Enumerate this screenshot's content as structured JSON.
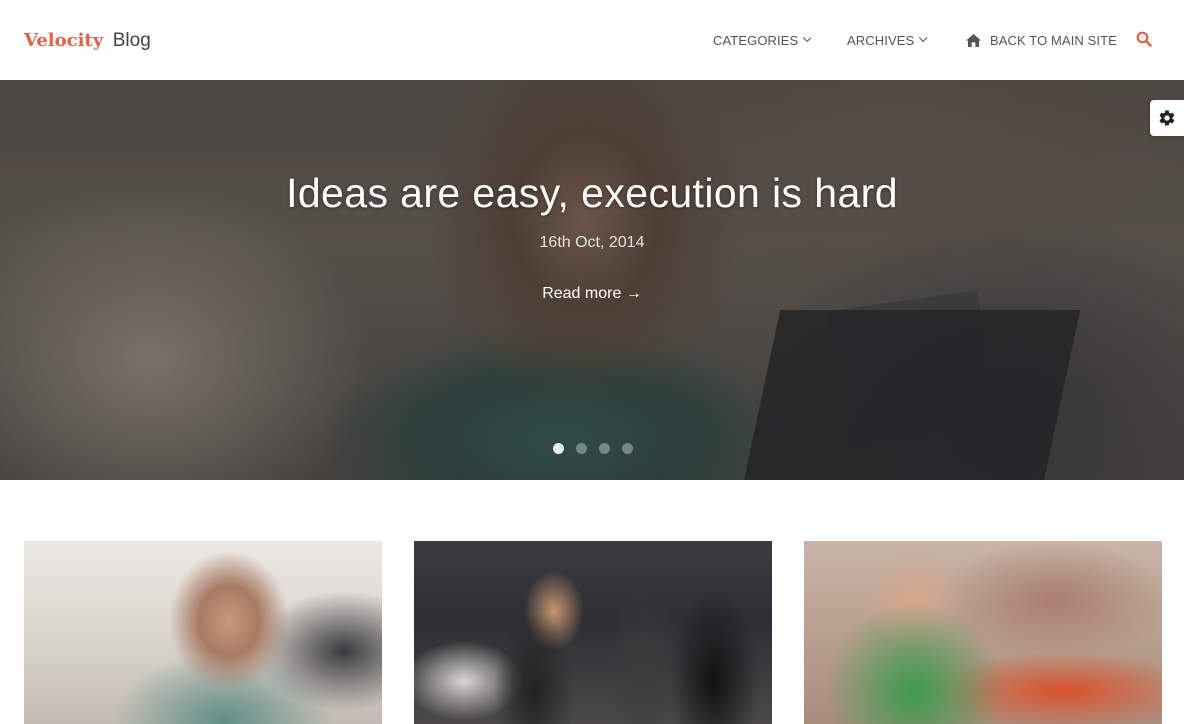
{
  "header": {
    "logo_brand": "Velocity",
    "logo_suffix": "Blog",
    "nav": {
      "categories": "CATEGORIES",
      "archives": "ARCHIVES",
      "back": "BACK TO MAIN SITE"
    },
    "icons": {
      "home": "home-icon",
      "search": "search-icon",
      "chevron": "chevron-down-icon"
    },
    "accent_color": "#e5624a"
  },
  "hero": {
    "title": "Ideas are easy, execution is hard",
    "date": "16th Oct, 2014",
    "read_more": "Read more →",
    "slides_total": 4,
    "active_slide": 1
  },
  "settings": {
    "icon": "gear-icon"
  },
  "cards": [
    {
      "image": "person-with-headset-photo"
    },
    {
      "image": "group-at-event-photo"
    },
    {
      "image": "person-on-laptop-photo"
    }
  ]
}
